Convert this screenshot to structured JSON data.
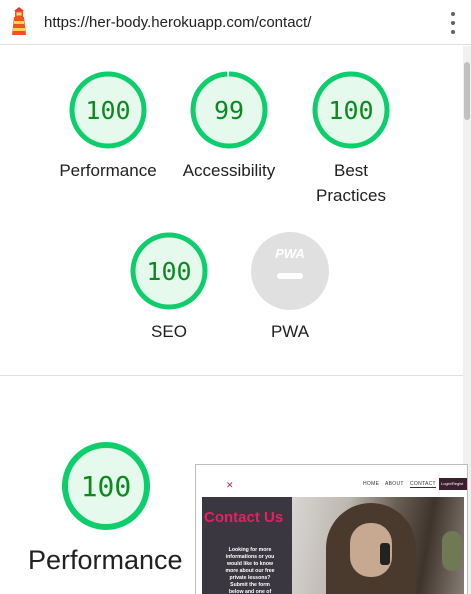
{
  "browser": {
    "url": "https://her-body.herokuapp.com/contact/",
    "logo_icon": "lighthouse-icon",
    "menu_icon": "kebab-menu-icon"
  },
  "colors": {
    "pass_ring": "#0cce6b",
    "pass_fill": "#e5f9ed",
    "pass_text": "#0b8a1e",
    "pwa_fill": "#e0e0e0"
  },
  "gauges": [
    {
      "score": "100",
      "value": 100,
      "label": "Performance"
    },
    {
      "score": "99",
      "value": 99,
      "label": "Accessibility"
    },
    {
      "score": "100",
      "value": 100,
      "label": "Best Practices"
    },
    {
      "score": "100",
      "value": 100,
      "label": "SEO"
    },
    {
      "label": "PWA",
      "badge_text": "PWA"
    }
  ],
  "performance_section": {
    "score": "100",
    "value": 100,
    "label": "Performance"
  },
  "thumbnail": {
    "nav": [
      "HOME",
      "ABOUT",
      "CONTACT",
      "Login/Regist"
    ],
    "hero_title": "Contact Us",
    "hero_text": "Looking for more informations or you would like to know more about our free private lessons? Submit the form below and one of our"
  }
}
